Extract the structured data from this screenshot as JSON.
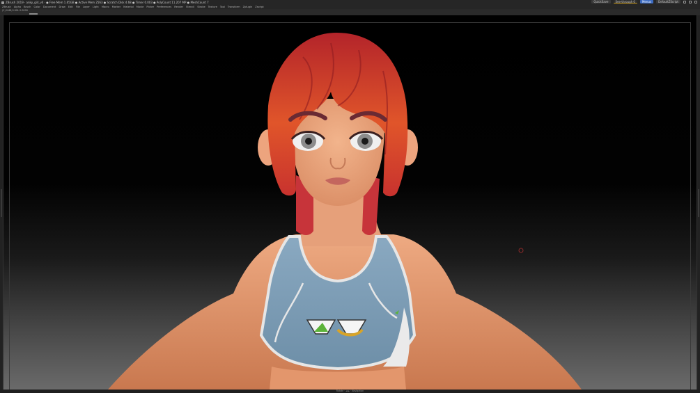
{
  "titlebar": {
    "title": "ZBrush 2019 · anky_girl_v4 · ● Free Mem 1.65GB ● Active Mem 2563 ● Scratch Disk 4.68 ● Timer 0.003 ● PolyCount 11.207 MP ● MeshCount 7",
    "quicksave": "QuickSave",
    "see_through": "See-through 0",
    "menus_label": "Menus",
    "default_script": "DefaultZScript"
  },
  "menubar": {
    "items": [
      "ZBrush",
      "Alpha",
      "Brush",
      "Color",
      "Document",
      "Draw",
      "Edit",
      "File",
      "Layer",
      "Light",
      "Macro",
      "Marker",
      "Material",
      "Movie",
      "Picker",
      "Preferences",
      "Render",
      "Stencil",
      "Stroke",
      "Texture",
      "Tool",
      "Transform",
      "Zplugin",
      "Zscript"
    ]
  },
  "subbar": {
    "text": "(1) 0.68,0.9SL 0.0000"
  },
  "statusbar": {
    "text": "Rotate · ◄ ► · Navigation"
  },
  "colors": {
    "skin": "#e9a47c",
    "hair_top": "#c9322a",
    "hair_bottom": "#e8622a",
    "top_fabric": "#7c9cb5",
    "trim": "#e8e8e8",
    "logo_green": "#5cb33a",
    "logo_yellow": "#d8a428"
  },
  "icons": [
    "app-icon",
    "window-controls-icon",
    "cursor-target-icon"
  ]
}
